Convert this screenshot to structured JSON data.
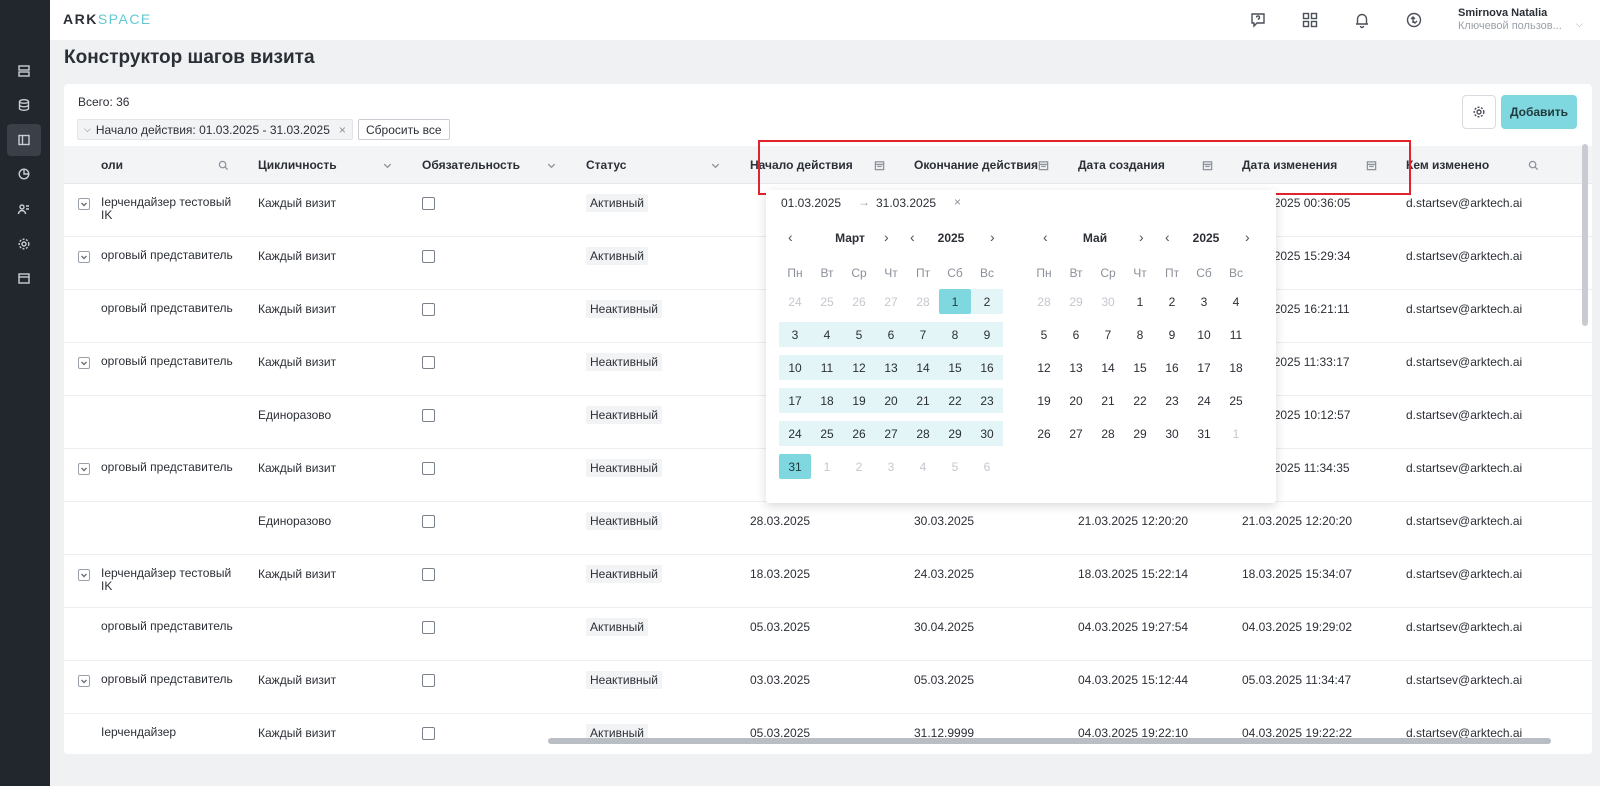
{
  "app": {
    "logo_part1": "ARK",
    "logo_part2": "SPACE"
  },
  "user": {
    "name": "Smirnova Natalia",
    "role": "Ключевой пользов..."
  },
  "page": {
    "title": "Конструктор шагов визита"
  },
  "toolbar": {
    "total": "Всего: 36",
    "filter_chip": "Начало действия: 01.03.2025 - 31.03.2025",
    "reset_label": "Сбросить все",
    "add_label": "Добавить"
  },
  "columns": [
    "оли",
    "Цикличность",
    "Обязательность",
    "Статус",
    "Начало действия",
    "Окончание действия",
    "Дата создания",
    "Дата изменения",
    "Кем изменено"
  ],
  "rows": [
    {
      "role": "Iерчендайзер тестовый IK",
      "cycle": "Каждый визит",
      "status": "Активный",
      "start": "",
      "end": "",
      "created": "",
      "modified": "8.03.2025 00:36:05",
      "by": "d.startsev@arktech.ai",
      "expand": true
    },
    {
      "role": "орговый представитель",
      "cycle": "Каждый визит",
      "status": "Активный",
      "start": "",
      "end": "",
      "created": "",
      "modified": "6.03.2025 15:29:34",
      "by": "d.startsev@arktech.ai",
      "expand": true
    },
    {
      "role": "орговый представитель",
      "cycle": "Каждый визит",
      "status": "Неактивный",
      "start": "",
      "end": "",
      "created": "",
      "modified": "5.03.2025 16:21:11",
      "by": "d.startsev@arktech.ai",
      "expand": false
    },
    {
      "role": "орговый представитель",
      "cycle": "Каждый визит",
      "status": "Неактивный",
      "start": "",
      "end": "",
      "created": "",
      "modified": "5.03.2025 11:33:17",
      "by": "d.startsev@arktech.ai",
      "expand": true
    },
    {
      "role": "",
      "cycle": "Единоразово",
      "status": "Неактивный",
      "start": "",
      "end": "",
      "created": "",
      "modified": "8.03.2025 10:12:57",
      "by": "d.startsev@arktech.ai",
      "expand": false
    },
    {
      "role": "орговый представитель",
      "cycle": "Каждый визит",
      "status": "Неактивный",
      "start": "",
      "end": "",
      "created": "",
      "modified": "5.03.2025 11:34:35",
      "by": "d.startsev@arktech.ai",
      "expand": true
    },
    {
      "role": "",
      "cycle": "Единоразово",
      "status": "Неактивный",
      "start": "28.03.2025",
      "end": "30.03.2025",
      "created": "21.03.2025 12:20:20",
      "modified": "21.03.2025 12:20:20",
      "by": "d.startsev@arktech.ai",
      "expand": false
    },
    {
      "role": "Iерчендайзер тестовый IK",
      "cycle": "Каждый визит",
      "status": "Неактивный",
      "start": "18.03.2025",
      "end": "24.03.2025",
      "created": "18.03.2025 15:22:14",
      "modified": "18.03.2025 15:34:07",
      "by": "d.startsev@arktech.ai",
      "expand": true
    },
    {
      "role": "орговый представитель",
      "cycle": "",
      "status": "Активный",
      "start": "05.03.2025",
      "end": "30.04.2025",
      "created": "04.03.2025 19:27:54",
      "modified": "04.03.2025 19:29:02",
      "by": "d.startsev@arktech.ai",
      "expand": false
    },
    {
      "role": "орговый представитель",
      "cycle": "Каждый визит",
      "status": "Неактивный",
      "start": "03.03.2025",
      "end": "05.03.2025",
      "created": "04.03.2025 15:12:44",
      "modified": "05.03.2025 11:34:47",
      "by": "d.startsev@arktech.ai",
      "expand": true
    },
    {
      "role": "Iерчендайзер",
      "cycle": "Каждый визит",
      "status": "Активный",
      "start": "05.03.2025",
      "end": "31.12.9999",
      "created": "04.03.2025 19:22:10",
      "modified": "04.03.2025 19:22:22",
      "by": "d.startsev@arktech.ai",
      "expand": false
    }
  ],
  "picker": {
    "start": "01.03.2025",
    "arrow": "→",
    "end": "31.03.2025",
    "clear": "×",
    "weekdays": [
      "Пн",
      "Вт",
      "Ср",
      "Чт",
      "Пт",
      "Сб",
      "Вс"
    ],
    "left": {
      "month": "Март",
      "year": "2025",
      "days": [
        [
          "24",
          "25",
          "26",
          "27",
          "28",
          "1",
          "2"
        ],
        [
          "3",
          "4",
          "5",
          "6",
          "7",
          "8",
          "9"
        ],
        [
          "10",
          "11",
          "12",
          "13",
          "14",
          "15",
          "16"
        ],
        [
          "17",
          "18",
          "19",
          "20",
          "21",
          "22",
          "23"
        ],
        [
          "24",
          "25",
          "26",
          "27",
          "28",
          "29",
          "30"
        ],
        [
          "31",
          "1",
          "2",
          "3",
          "4",
          "5",
          "6"
        ]
      ]
    },
    "right": {
      "month": "Май",
      "year": "2025",
      "days": [
        [
          "28",
          "29",
          "30",
          "1",
          "2",
          "3",
          "4"
        ],
        [
          "5",
          "6",
          "7",
          "8",
          "9",
          "10",
          "11"
        ],
        [
          "12",
          "13",
          "14",
          "15",
          "16",
          "17",
          "18"
        ],
        [
          "19",
          "20",
          "21",
          "22",
          "23",
          "24",
          "25"
        ],
        [
          "26",
          "27",
          "28",
          "29",
          "30",
          "31",
          "1"
        ]
      ]
    }
  },
  "colors": {
    "accent": "#7fd7df",
    "range": "#e3f5f7",
    "sidebar": "#22262d",
    "highlight": "#e0232d"
  }
}
